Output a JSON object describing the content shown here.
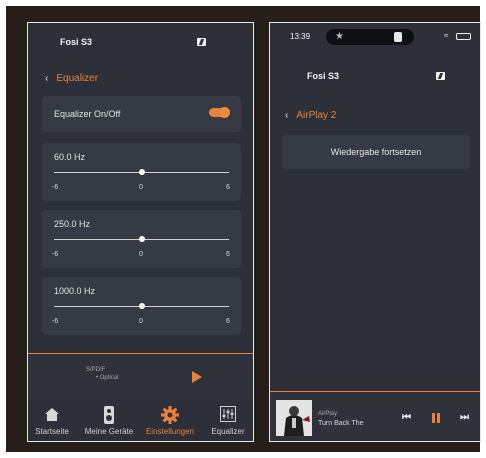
{
  "left": {
    "device_title": "Fosi S3",
    "back_label": "Equalizer",
    "toggle_label": "Equalizer On/Off",
    "toggle_on": true,
    "bands": [
      {
        "label": "60.0 Hz",
        "min": "-6",
        "mid": "0",
        "max": "6",
        "value": 0
      },
      {
        "label": "250.0 Hz",
        "min": "-6",
        "mid": "0",
        "max": "6",
        "value": 0
      },
      {
        "label": "1000.0 Hz",
        "min": "-6",
        "mid": "0",
        "max": "6",
        "value": 0
      }
    ],
    "player": {
      "source_line1": "S/PDIF",
      "source_line2": "• Optical"
    },
    "tabs": [
      {
        "label": "Startseite",
        "icon": "home-icon"
      },
      {
        "label": "Meine Geräte",
        "icon": "speaker-icon"
      },
      {
        "label": "Einstellungen",
        "icon": "gear-icon",
        "active": true
      },
      {
        "label": "Equalizer",
        "icon": "equalizer-icon"
      }
    ]
  },
  "right": {
    "time": "13:39",
    "device_title": "Fosi S3",
    "back_label": "AirPlay 2",
    "resume_label": "Wiedergabe fortsetzen",
    "player": {
      "source": "AirPlay",
      "track": "Turn Back The"
    }
  },
  "colors": {
    "accent": "#e8823a",
    "background": "#2d3038",
    "card": "#363a44"
  }
}
